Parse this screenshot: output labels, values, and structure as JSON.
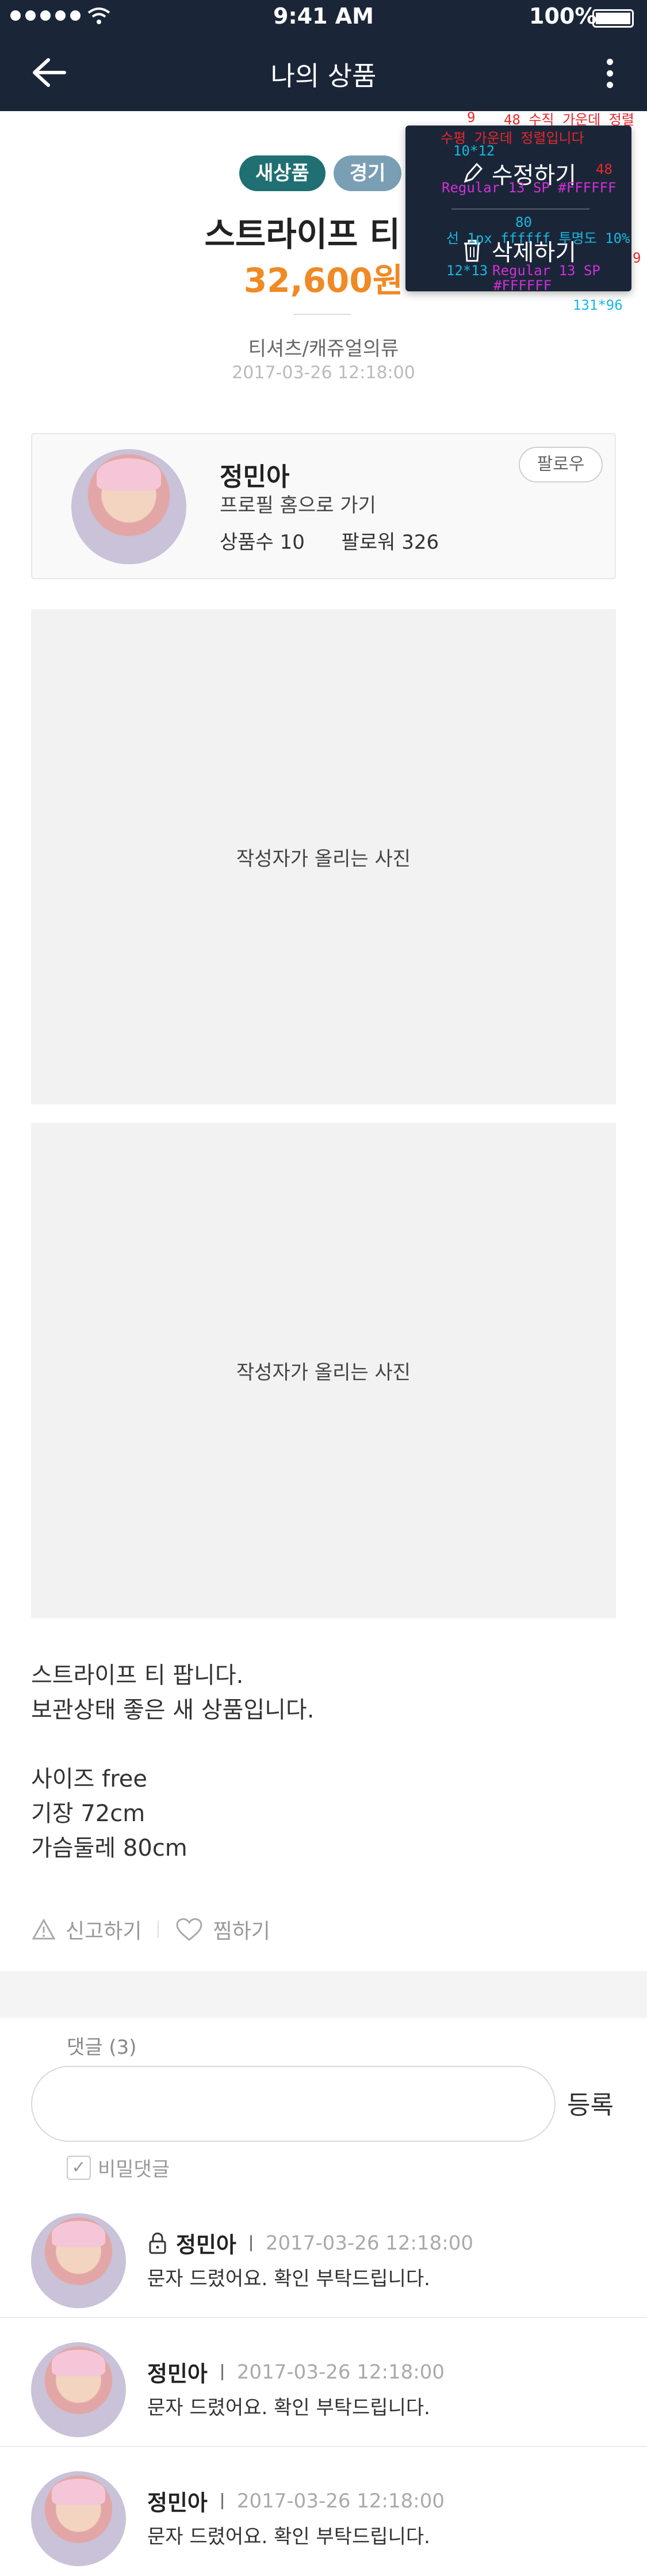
{
  "status": {
    "time": "9:41 AM",
    "battery": "100%"
  },
  "nav": {
    "title": "나의 상품",
    "back_icon": "arrow-left-icon",
    "more_icon": "kebab-menu-icon"
  },
  "product": {
    "tags": [
      "새상품",
      "경기"
    ],
    "title": "스트라이프 티 팔",
    "price": "32,600원",
    "category": "티셔츠/캐쥬얼의류",
    "date": "2017-03-26  12:18:00"
  },
  "menu": {
    "edit_label": "수정하기",
    "delete_label": "삭제하기",
    "spec": {
      "pad_top": "9",
      "center_note": "48 수직 가운데 정렬",
      "h_center_note": "수평 가운데 정렬입니다",
      "icon1_size": "10*12",
      "height": "48",
      "font1": "Regular 13 SP #FFFFFF",
      "sep_width": "80",
      "sep_note": "선 1px ffffff 투명도 10%",
      "icon2_size": "12*13",
      "font2": "Regular 13 SP",
      "font2b": "#FFFFFF",
      "pad_right": "9",
      "box_size": "131*96"
    }
  },
  "seller": {
    "name": "정민아",
    "link": "프로필 홈으로 가기",
    "items_label": "상품수 10",
    "followers_label": "팔로워 326",
    "follow_button": "팔로우"
  },
  "photos": [
    "작성자가 올리는 사진",
    "작성자가 올리는 사진"
  ],
  "description": [
    "스트라이프 티 팝니다.",
    "보관상태 좋은 새 상품입니다.",
    "",
    "사이즈 free",
    "기장 72cm",
    "가슴둘레 80cm"
  ],
  "actions": {
    "report": "신고하기",
    "like": "찜하기"
  },
  "comments_section": {
    "count_label": "댓글 (3)",
    "submit": "등록",
    "secret_label": "비밀댓글",
    "items": [
      {
        "name": "정민아",
        "locked": true,
        "date": "2017-03-26  12:18:00",
        "text": "문자 드렸어요. 확인 부탁드립니다."
      },
      {
        "name": "정민아",
        "locked": false,
        "date": "2017-03-26  12:18:00",
        "text": "문자 드렸어요. 확인 부탁드립니다."
      },
      {
        "name": "정민아",
        "locked": false,
        "date": "2017-03-26  12:18:00",
        "text": "문자 드렸어요. 확인 부탁드립니다."
      }
    ]
  },
  "colors": {
    "nav_bg": "#1a2638",
    "price": "#f08a24",
    "tag_new": "#1f6f73",
    "tag_grade": "#7a9fb5"
  }
}
